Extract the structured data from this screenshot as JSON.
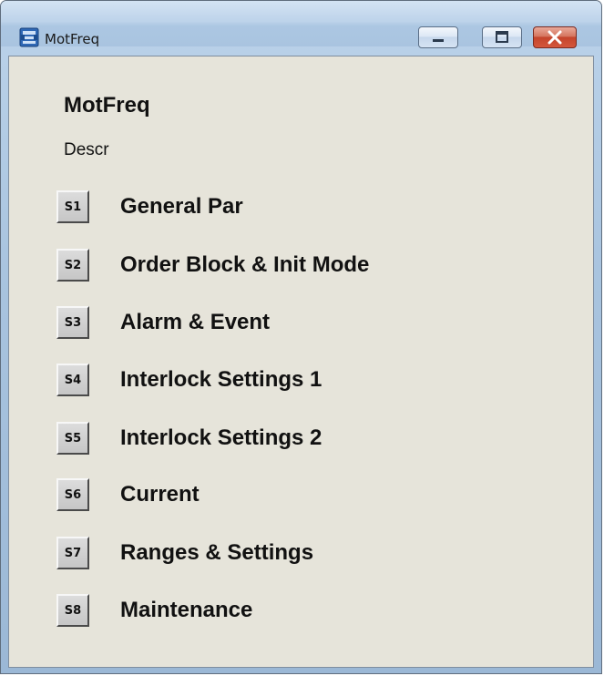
{
  "window": {
    "title": "MotFreq",
    "controls": {
      "minimize": "minimize",
      "maximize": "maximize",
      "close": "close"
    }
  },
  "header": {
    "title": "MotFreq",
    "description": "Descr"
  },
  "menu": [
    {
      "button": "S1",
      "label": "General Par"
    },
    {
      "button": "S2",
      "label": "Order Block & Init Mode"
    },
    {
      "button": "S3",
      "label": "Alarm & Event"
    },
    {
      "button": "S4",
      "label": "Interlock Settings 1"
    },
    {
      "button": "S5",
      "label": "Interlock Settings 2"
    },
    {
      "button": "S6",
      "label": "Current"
    },
    {
      "button": "S7",
      "label": "Ranges & Settings"
    },
    {
      "button": "S8",
      "label": "Maintenance"
    }
  ],
  "colors": {
    "panel_bg": "#e6e4da",
    "close_button": "#c4442b",
    "title_bar": "#bcd3ea"
  }
}
